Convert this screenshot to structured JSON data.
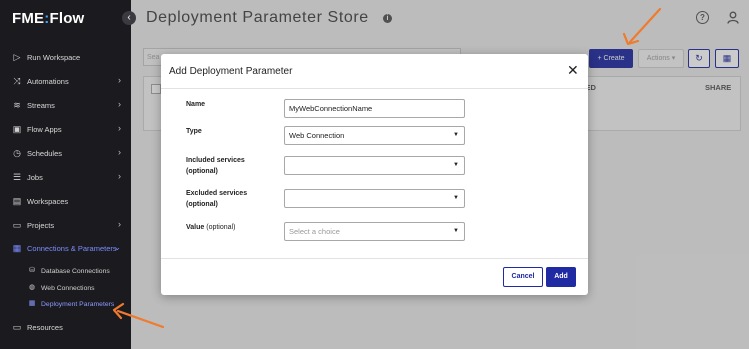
{
  "app": {
    "logo_main": "FME",
    "logo_colon": ":",
    "logo_suffix": "Flow"
  },
  "sidebar": {
    "items": [
      {
        "label": "Run Workspace",
        "icon": "play-icon",
        "chevron": false
      },
      {
        "label": "Automations",
        "icon": "automations-icon",
        "chevron": true
      },
      {
        "label": "Streams",
        "icon": "streams-icon",
        "chevron": true
      },
      {
        "label": "Flow Apps",
        "icon": "flow-apps-icon",
        "chevron": true
      },
      {
        "label": "Schedules",
        "icon": "clock-icon",
        "chevron": true
      },
      {
        "label": "Jobs",
        "icon": "jobs-icon",
        "chevron": true
      },
      {
        "label": "Workspaces",
        "icon": "workspaces-icon",
        "chevron": false
      },
      {
        "label": "Projects",
        "icon": "folder-icon",
        "chevron": true
      },
      {
        "label": "Connections & Parameters",
        "icon": "connections-icon",
        "chevron": true,
        "active": true
      }
    ],
    "sub_items": [
      {
        "label": "Database Connections",
        "icon": "database-icon"
      },
      {
        "label": "Web Connections",
        "icon": "globe-icon"
      },
      {
        "label": "Deployment Parameters",
        "icon": "deployment-params-icon",
        "active": true
      }
    ],
    "resources": {
      "label": "Resources",
      "icon": "resources-folder-icon"
    }
  },
  "header": {
    "title": "Deployment Parameter Store"
  },
  "toolbar": {
    "search_placeholder": "Sea",
    "create_label": "Create",
    "actions_label": "Actions"
  },
  "table": {
    "columns": {
      "created": "ATED",
      "share": "SHARE"
    }
  },
  "dialog": {
    "title": "Add Deployment Parameter",
    "fields": {
      "name": {
        "label": "Name",
        "value": "MyWebConnectionName"
      },
      "type": {
        "label": "Type",
        "value": "Web Connection"
      },
      "included": {
        "label": "Included services",
        "optional": "(optional)",
        "value": ""
      },
      "excluded": {
        "label": "Excluded services",
        "optional": "(optional)",
        "value": ""
      },
      "value": {
        "label": "Value",
        "optional": "(optional)",
        "placeholder": "Select a choice"
      }
    },
    "cancel_label": "Cancel",
    "add_label": "Add"
  },
  "colors": {
    "accent": "#1f2aa3",
    "sidebar_bg": "#1b1b1f",
    "active_nav": "#7a8cff",
    "annotation_arrow": "#f07a2d"
  }
}
